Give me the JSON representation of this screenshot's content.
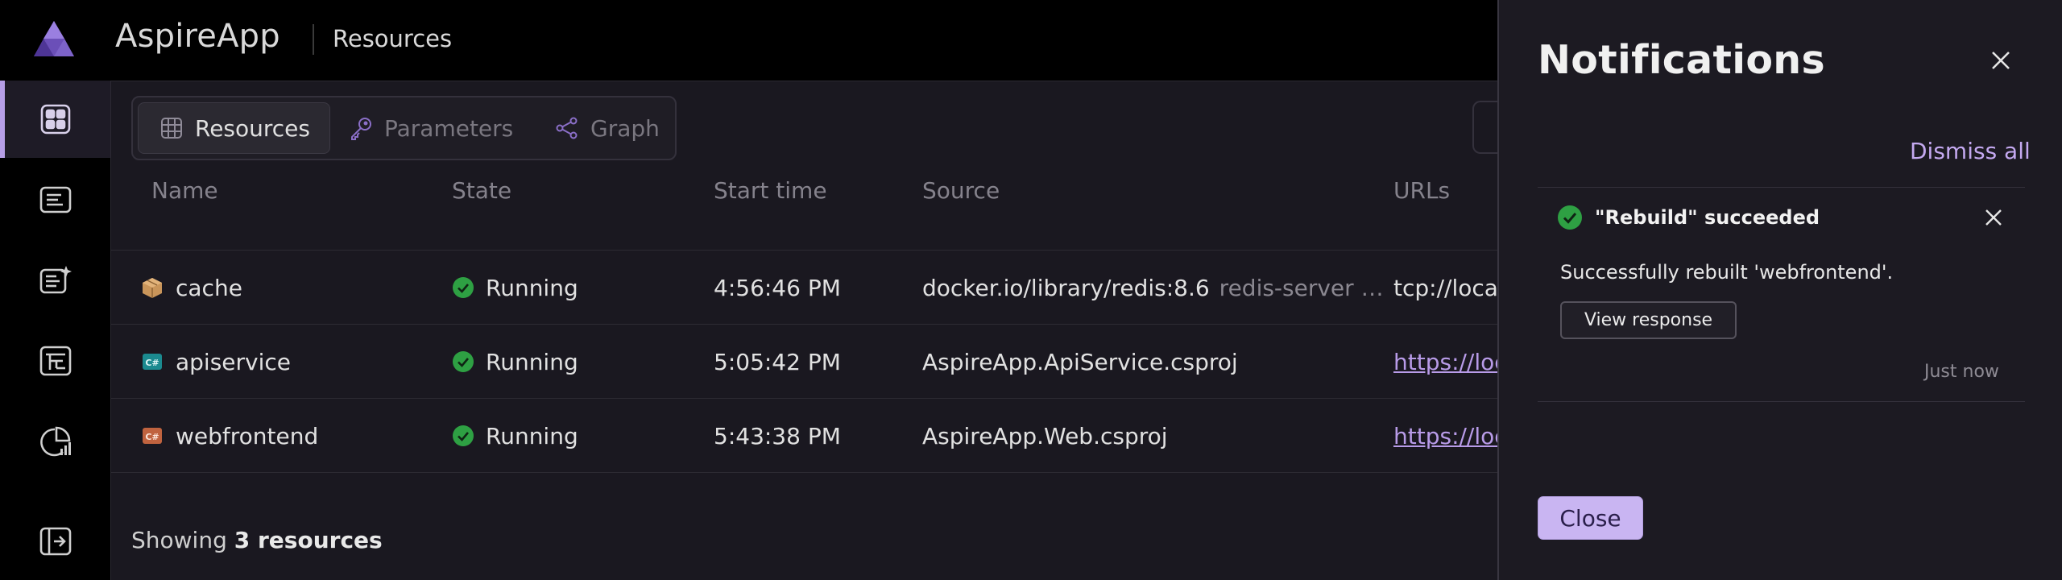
{
  "header": {
    "app_title": "AspireApp",
    "page_crumb": "Resources"
  },
  "rail": {
    "items": [
      {
        "icon": "resources-grid-icon",
        "active": true
      },
      {
        "icon": "console-logs-icon",
        "active": false
      },
      {
        "icon": "structured-logs-icon",
        "active": false
      },
      {
        "icon": "traces-icon",
        "active": false
      },
      {
        "icon": "metrics-icon",
        "active": false
      },
      {
        "icon": "collapse-sidebar-icon",
        "active": false
      }
    ]
  },
  "tabs": [
    {
      "label": "Resources",
      "icon": "table-icon",
      "selected": true
    },
    {
      "label": "Parameters",
      "icon": "key-icon",
      "selected": false
    },
    {
      "label": "Graph",
      "icon": "share-graph-icon",
      "selected": false
    }
  ],
  "grid": {
    "columns": [
      "Name",
      "State",
      "Start time",
      "Source",
      "URLs"
    ],
    "rows": [
      {
        "name": "cache",
        "type_icon": "container-box-icon",
        "state": "Running",
        "start_time": "4:56:46 PM",
        "source": "docker.io/library/redis:8.6",
        "source_extra": "redis-server …",
        "url": "tcp://loca",
        "url_is_link": false
      },
      {
        "name": "apiservice",
        "type_icon": "csharp-project-icon",
        "state": "Running",
        "start_time": "5:05:42 PM",
        "source": "AspireApp.ApiService.csproj",
        "source_extra": "",
        "url": "https://loc",
        "url_is_link": true
      },
      {
        "name": "webfrontend",
        "type_icon": "csharp-project-icon",
        "state": "Running",
        "start_time": "5:43:38 PM",
        "source": "AspireApp.Web.csproj",
        "source_extra": "",
        "url": "https://loc",
        "url_is_link": true
      }
    ]
  },
  "footer": {
    "prefix": "Showing",
    "count_text": "3 resources"
  },
  "notifications": {
    "title": "Notifications",
    "dismiss_all": "Dismiss all",
    "items": [
      {
        "title": "\"Rebuild\" succeeded",
        "body": "Successfully rebuilt 'webfrontend'.",
        "action": "View response",
        "time": "Just now"
      }
    ],
    "close_label": "Close"
  },
  "colors": {
    "accent": "#b69ee6",
    "success": "#2ea043",
    "link": "#b89be8"
  }
}
